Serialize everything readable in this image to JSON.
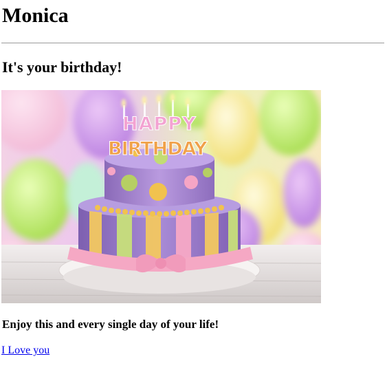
{
  "page": {
    "heading": "Monica",
    "subheading": "It's your birthday!",
    "message": "Enjoy this and every single day of your life!",
    "link_text": "I Love you"
  },
  "photo": {
    "topper_line1": "HAPPY",
    "topper_line2": "BIRTHDAY"
  },
  "colors": {
    "link": "#0000ee",
    "divider": "#9a9a9a",
    "cake_top": "#a98bd0",
    "cake_bottom": "#9c7fc9",
    "ribbon": "#f5a8c4",
    "balloon_purple": "#c98be6",
    "balloon_green": "#b7e86a",
    "balloon_yellow": "#f2e27a"
  }
}
